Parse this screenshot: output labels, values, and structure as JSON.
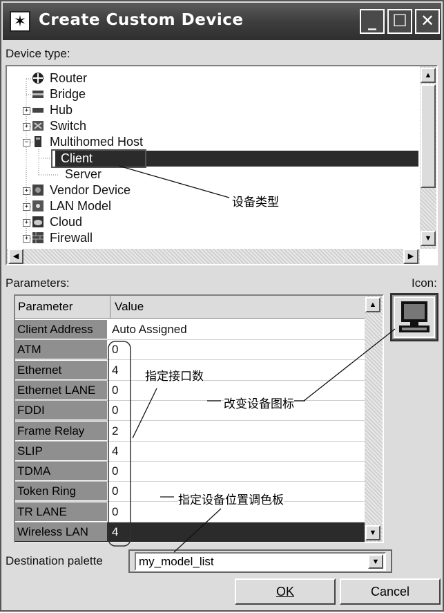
{
  "window": {
    "title": "Create Custom Device",
    "controls": {
      "minimize": "_",
      "maximize": "☐",
      "close": "✕"
    }
  },
  "device_type": {
    "label": "Device type:",
    "items": [
      {
        "label": "Router",
        "expander": ""
      },
      {
        "label": "Bridge",
        "expander": ""
      },
      {
        "label": "Hub",
        "expander": "+"
      },
      {
        "label": "Switch",
        "expander": "+"
      },
      {
        "label": "Multihomed Host",
        "expander": "−"
      },
      {
        "label": "Client",
        "expander": "",
        "selected": true
      },
      {
        "label": "Server",
        "expander": ""
      },
      {
        "label": "Vendor Device",
        "expander": "+"
      },
      {
        "label": "LAN Model",
        "expander": "+"
      },
      {
        "label": "Cloud",
        "expander": "+"
      },
      {
        "label": "Firewall",
        "expander": "+"
      }
    ]
  },
  "parameters": {
    "label": "Parameters:",
    "icon_label": "Icon:",
    "headers": {
      "parameter": "Parameter",
      "value": "Value"
    },
    "rows": [
      {
        "name": "Client Address",
        "value": "Auto Assigned"
      },
      {
        "name": "ATM",
        "value": "0"
      },
      {
        "name": "Ethernet",
        "value": "4"
      },
      {
        "name": "Ethernet LANE",
        "value": "0"
      },
      {
        "name": "FDDI",
        "value": "0"
      },
      {
        "name": "Frame Relay",
        "value": "2"
      },
      {
        "name": "SLIP",
        "value": "4"
      },
      {
        "name": "TDMA",
        "value": "0"
      },
      {
        "name": "Token Ring",
        "value": "0"
      },
      {
        "name": "TR LANE",
        "value": "0"
      },
      {
        "name": "Wireless LAN",
        "value": "4"
      }
    ]
  },
  "destination": {
    "label": "Destination palette",
    "value": "my_model_list"
  },
  "buttons": {
    "ok": "OK",
    "cancel": "Cancel"
  },
  "annotations": {
    "device_type": "设备类型",
    "interface_count": "指定接口数",
    "change_icon": "改变设备图标",
    "palette": "指定设备位置调色板"
  }
}
